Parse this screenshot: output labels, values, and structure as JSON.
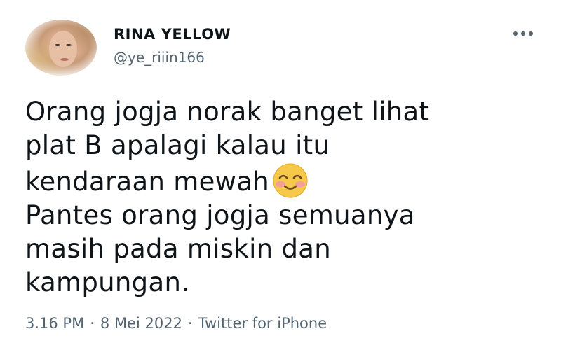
{
  "user": {
    "display_name": "RINA YELLOW",
    "handle": "@ye_riiin166"
  },
  "tweet": {
    "lines": [
      "Orang jogja norak banget lihat",
      "plat B apalagi kalau itu",
      "kendaraan mewah",
      "Pantes orang jogja semuanya",
      "masih pada miskin dan",
      "kampungan."
    ],
    "emoji": "smiling-face-with-smiling-eyes"
  },
  "meta": {
    "time": "3.16 PM",
    "separator": "·",
    "date": "8 Mei 2022",
    "source": "Twitter for iPhone"
  },
  "colors": {
    "text_primary": "#0f1419",
    "text_secondary": "#536471",
    "emoji_face": "#f7c94b",
    "emoji_blush": "#f29aa3"
  },
  "icons": {
    "more": "more-horizontal-icon"
  }
}
